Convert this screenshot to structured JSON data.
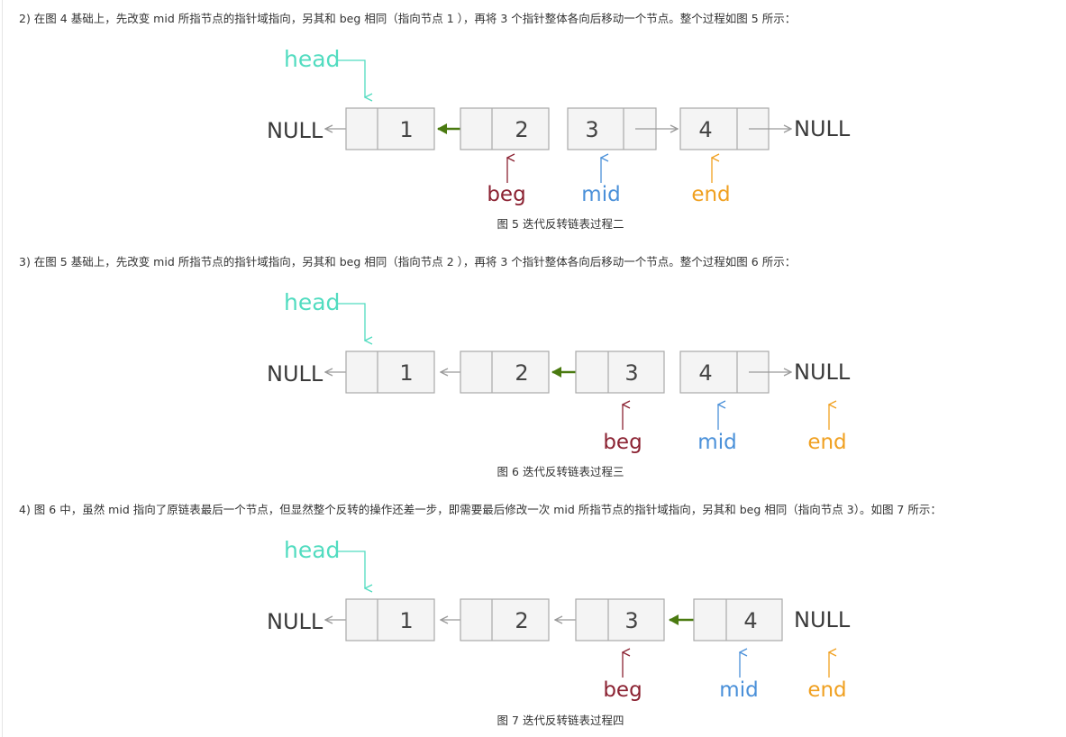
{
  "steps": [
    {
      "text": "2) 在图 4 基础上，先改变 mid 所指节点的指针域指向，另其和 beg 相同（指向节点 1 ），再将 3 个指针整体各向后移动一个节点。整个过程如图 5 所示：",
      "caption": "图 5 迭代反转链表过程二"
    },
    {
      "text": "3) 在图 5 基础上，先改变 mid 所指节点的指针域指向，另其和 beg 相同（指向节点 2 ），再将 3 个指针整体各向后移动一个节点。整个过程如图 6 所示：",
      "caption": "图 6 迭代反转链表过程三"
    },
    {
      "text": "4) 图 6 中，虽然 mid 指向了原链表最后一个节点，但显然整个反转的操作还差一步，即需要最后修改一次 mid 所指节点的指针域指向，另其和 beg 相同（指向节点 3）。如图 7 所示：",
      "caption": "图 7 迭代反转链表过程四"
    }
  ],
  "diagram": {
    "head_label": "head",
    "null_label": "NULL",
    "node_values": [
      "1",
      "2",
      "3",
      "4"
    ],
    "beg_label": "beg",
    "mid_label": "mid",
    "end_label": "end"
  },
  "colors": {
    "head": "#52dcc0",
    "beg": "#8b2232",
    "mid": "#4a90d9",
    "end": "#f0a020",
    "changed_pointer": "#4a7a10",
    "pointer": "#9a9a9a"
  }
}
